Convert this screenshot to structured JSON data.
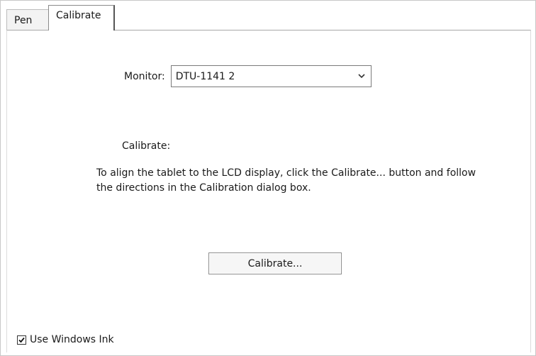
{
  "tabs": [
    {
      "label": "Pen",
      "selected": false
    },
    {
      "label": "Calibrate",
      "selected": true
    }
  ],
  "monitor": {
    "label": "Monitor:",
    "selected_value": "DTU-1141 2",
    "dropdown_icon": "chevron-down-icon"
  },
  "calibrate": {
    "label": "Calibrate:",
    "instructions": "To align the tablet to the LCD display, click the Calibrate... button and follow the directions in the Calibration dialog box.",
    "button_label": "Calibrate..."
  },
  "windows_ink": {
    "label": "Use Windows Ink",
    "checked": true
  }
}
